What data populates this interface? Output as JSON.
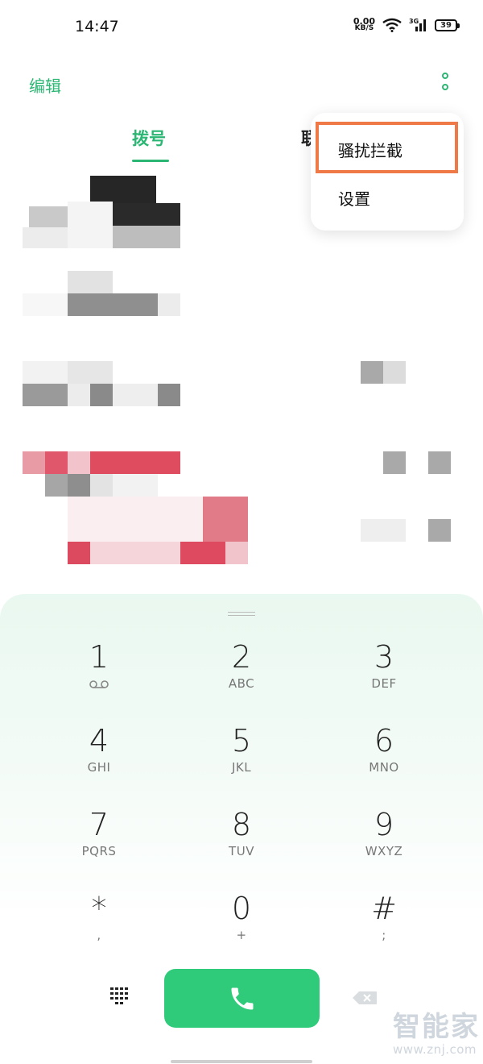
{
  "status_bar": {
    "time": "14:47",
    "net_speed_value": "0.00",
    "net_speed_unit": "KB/S",
    "battery": "39"
  },
  "header": {
    "edit_label": "编辑",
    "more_icon": "more-vertical-icon"
  },
  "tabs": [
    {
      "label": "拨号",
      "active": true
    },
    {
      "label": "联系人",
      "active": false
    }
  ],
  "menu": {
    "items": [
      {
        "label": "骚扰拦截",
        "highlighted": true
      },
      {
        "label": "设置",
        "highlighted": false
      }
    ]
  },
  "dialpad": {
    "keys": [
      {
        "digit": "1",
        "letters": ""
      },
      {
        "digit": "2",
        "letters": "ABC"
      },
      {
        "digit": "3",
        "letters": "DEF"
      },
      {
        "digit": "4",
        "letters": "GHI"
      },
      {
        "digit": "5",
        "letters": "JKL"
      },
      {
        "digit": "6",
        "letters": "MNO"
      },
      {
        "digit": "7",
        "letters": "PQRS"
      },
      {
        "digit": "8",
        "letters": "TUV"
      },
      {
        "digit": "9",
        "letters": "WXYZ"
      },
      {
        "digit": "*",
        "letters": ","
      },
      {
        "digit": "0",
        "letters": "+"
      },
      {
        "digit": "#",
        "letters": ";"
      }
    ]
  },
  "watermark": {
    "name": "智能家",
    "url": "www.znj.com"
  },
  "colors": {
    "accent": "#2bb673",
    "call_button": "#2fcb7b",
    "highlight": "#ef7a47"
  }
}
